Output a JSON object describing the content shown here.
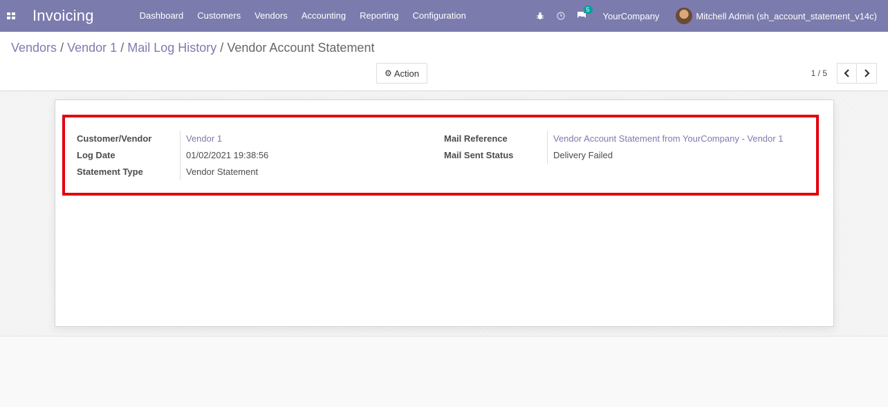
{
  "navbar": {
    "app_name": "Invoicing",
    "menu": [
      "Dashboard",
      "Customers",
      "Vendors",
      "Accounting",
      "Reporting",
      "Configuration"
    ],
    "chat_count": "5",
    "company": "YourCompany",
    "user": "Mitchell Admin (sh_account_statement_v14c)"
  },
  "breadcrumb": {
    "items": [
      "Vendors",
      "Vendor 1",
      "Mail Log History"
    ],
    "separator": "/",
    "current": "Vendor Account Statement"
  },
  "toolbar": {
    "action_label": "Action",
    "pager": "1 / 5"
  },
  "form": {
    "left": [
      {
        "label": "Customer/Vendor",
        "value": "Vendor 1"
      },
      {
        "label": "Log Date",
        "value": "01/02/2021 19:38:56"
      },
      {
        "label": "Statement Type",
        "value": "Vendor Statement"
      }
    ],
    "right": [
      {
        "label": "Mail Reference",
        "value": "Vendor Account Statement from YourCompany - Vendor 1"
      },
      {
        "label": "Mail Sent Status",
        "value": "Delivery Failed"
      }
    ]
  },
  "colors": {
    "navbar": "#7c7bad",
    "link": "#7c7bad",
    "highlight": "#e3000b",
    "badge": "#00a09d"
  },
  "icons": [
    "apps-icon",
    "bug-icon",
    "clock-icon",
    "chat-icon",
    "gear-icon",
    "chevron-left-icon",
    "chevron-right-icon"
  ]
}
